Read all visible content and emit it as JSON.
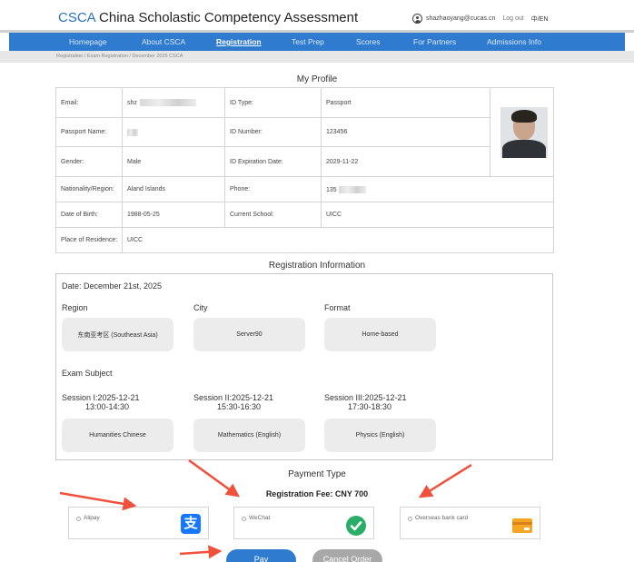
{
  "header": {
    "brand_abbr": "CSCA",
    "brand_name": "China Scholastic Competency Assessment",
    "user_email": "shazhaoyang@cucas.cn",
    "logout": "Log out",
    "language": "中/EN"
  },
  "nav": {
    "items": [
      "Homepage",
      "About CSCA",
      "Registration",
      "Test Prep",
      "Scores",
      "For Partners",
      "Admissions Info"
    ],
    "active": "Registration"
  },
  "breadcrumb": "Registration  /  Exam Registration  /  December 2025 CSCA",
  "profile": {
    "title": "My Profile",
    "email_label": "Email:",
    "email_value": "shz",
    "passport_name_label": "Passport Name:",
    "passport_name_value": "",
    "gender_label": "Gender:",
    "gender_value": "Male",
    "nationality_label": "Nationality/Region:",
    "nationality_value": "Aland Islands",
    "dob_label": "Date of Birth:",
    "dob_value": "1988-05-25",
    "residence_label": "Place of Residence:",
    "residence_value": "UICC",
    "id_type_label": "ID Type:",
    "id_type_value": "Passport",
    "id_number_label": "ID Number:",
    "id_number_value": "123456",
    "id_expiration_label": "ID Expiration Date:",
    "id_expiration_value": "2029-11-22",
    "phone_label": "Phone:",
    "phone_value": "135",
    "school_label": "Current School:",
    "school_value": "UICC"
  },
  "registration": {
    "title": "Registration Information",
    "date": "Date: December 21st, 2025",
    "region_label": "Region",
    "region_value": "东南亚考区 (Southeast Asia)",
    "city_label": "City",
    "city_value": "Server90",
    "format_label": "Format",
    "format_value": "Home-based",
    "subject_label": "Exam Subject",
    "sessions": [
      {
        "label": "Session I:2025-12-21",
        "time": "13:00-14:30",
        "subject": "Humanities Chinese"
      },
      {
        "label": "Session II:2025-12-21",
        "time": "15:30-16:30",
        "subject": "Mathematics (English)"
      },
      {
        "label": "Session III:2025-12-21",
        "time": "17:30-18:30",
        "subject": "Physics (English)"
      }
    ]
  },
  "payment": {
    "title": "Payment Type",
    "fee": "Registration Fee: CNY 700",
    "options": [
      {
        "label": "Alipay",
        "icon": "alipay-icon",
        "color": "#1677ff",
        "glyph": "支"
      },
      {
        "label": "WeChat",
        "icon": "wechat-pay-icon",
        "color": "#2aae67"
      },
      {
        "label": "Overseas bank card",
        "icon": "bank-card-icon",
        "color": "#f5a623"
      }
    ],
    "pay_button": "Pay",
    "cancel_button": "Cancel Order"
  },
  "colors": {
    "primary": "#2f7bd0",
    "annotation_arrow": "#f0503c",
    "cancel": "#a8a8a8"
  }
}
